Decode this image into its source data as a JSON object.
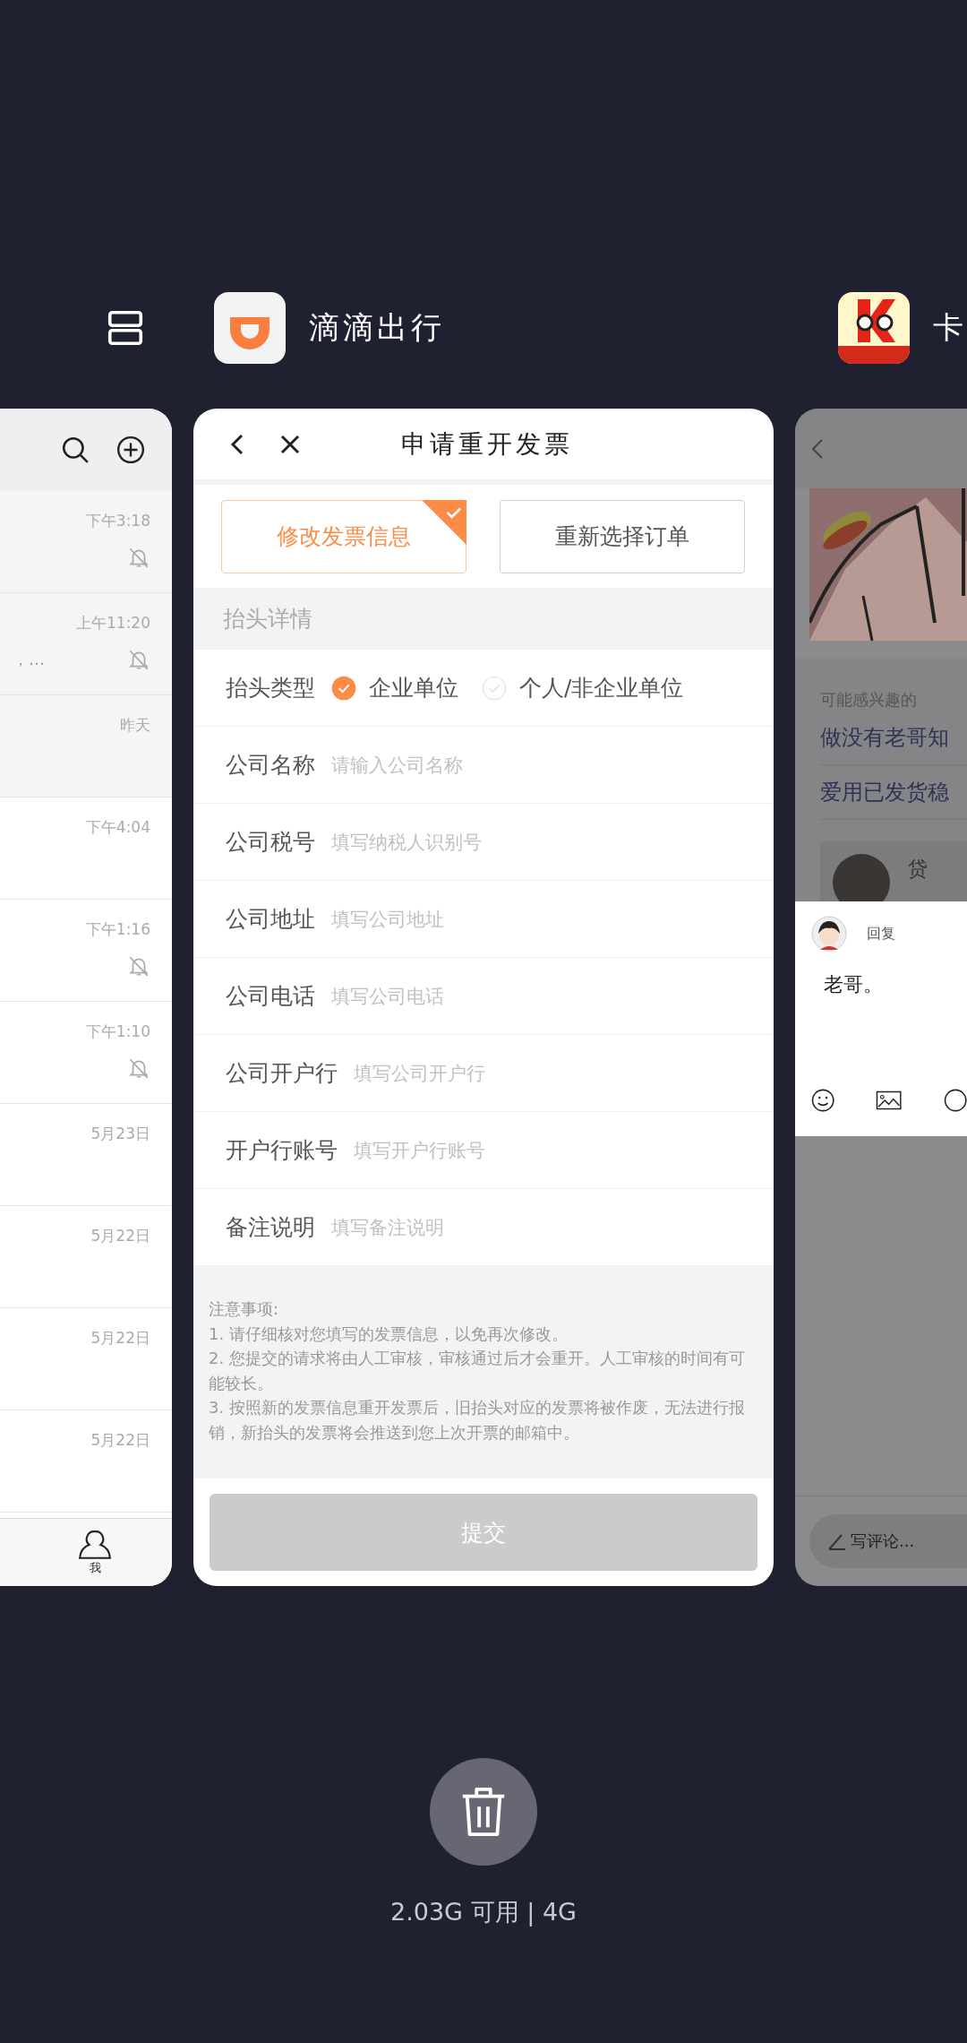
{
  "apps": [
    {
      "name": "滴滴出行"
    },
    {
      "name": "卡"
    }
  ],
  "left_card": {
    "rows": [
      {
        "time": "下午3:18",
        "muted": true,
        "pinned": true
      },
      {
        "time": "上午11:20",
        "muted": true,
        "pinned": true,
        "snippet": "，…"
      },
      {
        "time": "昨天",
        "muted": false,
        "pinned": true
      },
      {
        "time": "下午4:04",
        "muted": false,
        "pinned": false
      },
      {
        "time": "下午1:16",
        "muted": true,
        "pinned": false
      },
      {
        "time": "下午1:10",
        "muted": true,
        "pinned": false
      },
      {
        "time": "5月23日",
        "muted": false,
        "pinned": false
      },
      {
        "time": "5月22日",
        "muted": false,
        "pinned": false
      },
      {
        "time": "5月22日",
        "muted": false,
        "pinned": false
      },
      {
        "time": "5月22日",
        "muted": false,
        "pinned": false
      }
    ],
    "tab": "我"
  },
  "center_card": {
    "title": "申请重开发票",
    "mode_tabs": [
      {
        "label": "修改发票信息",
        "selected": true
      },
      {
        "label": "重新选择订单",
        "selected": false
      }
    ],
    "section": "抬头详情",
    "type_row": {
      "label": "抬头类型",
      "options": [
        {
          "label": "企业单位",
          "selected": true
        },
        {
          "label": "个人/非企业单位",
          "selected": false
        }
      ]
    },
    "fields": [
      {
        "label": "公司名称",
        "placeholder": "请输入公司名称"
      },
      {
        "label": "公司税号",
        "placeholder": "填写纳税人识别号"
      },
      {
        "label": "公司地址",
        "placeholder": "填写公司地址"
      },
      {
        "label": "公司电话",
        "placeholder": "填写公司电话"
      },
      {
        "label": "公司开户行",
        "placeholder": "填写公司开户行"
      },
      {
        "label": "开户行账号",
        "placeholder": "填写开户行账号"
      },
      {
        "label": "备注说明",
        "placeholder": "填写备注说明"
      }
    ],
    "notes": [
      "注意事项:",
      "1. 请仔细核对您填写的发票信息，以免再次修改。",
      "2. 您提交的请求将由人工审核，审核通过后才会重开。人工审核的时间有可能较长。",
      "3. 按照新的发票信息重开发票后，旧抬头对应的发票将被作废，无法进行报销，新抬头的发票将会推送到您上次开票的邮箱中。"
    ],
    "submit": {
      "label": "提交",
      "disabled": true
    }
  },
  "right_card": {
    "section_label": "可能感兴趣的",
    "links": [
      "做没有老哥知",
      "爱用已发货稳"
    ],
    "post_author": "贷",
    "reply_popup": {
      "label": "回复",
      "text": "老哥。"
    },
    "comment_placeholder": "写评论..."
  },
  "memory": "2.03G 可用 | 4G"
}
